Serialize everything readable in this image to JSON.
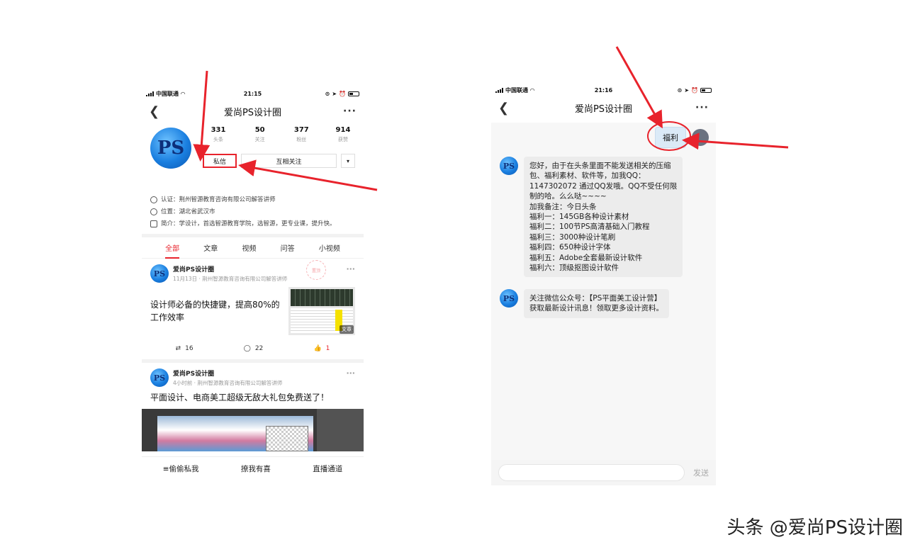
{
  "left_phone": {
    "status": {
      "carrier": "中国联通",
      "time": "21:15"
    },
    "nav": {
      "title": "爱尚PS设计圈"
    },
    "profile": {
      "avatar_text": "PS",
      "stats": [
        {
          "num": "331",
          "label": "头条"
        },
        {
          "num": "50",
          "label": "关注"
        },
        {
          "num": "377",
          "label": "粉丝"
        },
        {
          "num": "914",
          "label": "获赞"
        }
      ],
      "buttons": {
        "message": "私信",
        "follow": "互相关注",
        "dropdown": "▾"
      },
      "cert": "认证：荆州智源教育咨询有限公司解答讲师",
      "location": "位置：湖北省武汉市",
      "bio": "简介：学设计，首选智源教育学院，选智源，更专业课，提升快。"
    },
    "tabs": [
      "全部",
      "文章",
      "视频",
      "问答",
      "小视频"
    ],
    "post1": {
      "author": "爱尚PS设计圈",
      "meta": "11月13日 · 荆州智源教育咨询有限公司解答讲师",
      "title": "设计师必备的快捷键，提高80%的工作效率",
      "thumb_tag": "文章",
      "stamp": "置顶",
      "reposts": "16",
      "comments": "22",
      "likes": "1"
    },
    "post2": {
      "author": "爱尚PS设计圈",
      "meta": "4小时前 · 荆州智源教育咨询有限公司解答讲师",
      "title": "平面设计、电商美工超级无敌大礼包免费送了！"
    },
    "bottom_menu": [
      "≡偷偷私我",
      "撩我有喜",
      "直播通道"
    ]
  },
  "right_phone": {
    "status": {
      "carrier": "中国联通",
      "time": "21:16"
    },
    "nav": {
      "title": "爱尚PS设计圈"
    },
    "sent_message": "福利",
    "recv1_lines": [
      "您好，由于在头条里面不能发送相关的压缩",
      "包、福利素材、软件等，加我QQ：",
      "1147302072 通过QQ发哦。QQ不受任何限",
      "制的哈。么么哒~~~~",
      "加我备注：今日头条",
      "福利一：145GB各种设计素材",
      "福利二：100节PS高清基础入门教程",
      "福利三：3000种设计笔刷",
      "福利四：650种设计字体",
      "福利五：Adobe全套最新设计软件",
      "福利六：顶级抠图设计软件"
    ],
    "recv2_lines": [
      "关注微信公众号：【PS平面美工设计营】",
      "获取最新设计讯息！领取更多设计资料。"
    ],
    "send_label": "发送"
  },
  "watermark": "头条 @爱尚PS设计圈",
  "colors": {
    "accent_red": "#e8232c",
    "logo_blue": "#1a7fe0"
  }
}
